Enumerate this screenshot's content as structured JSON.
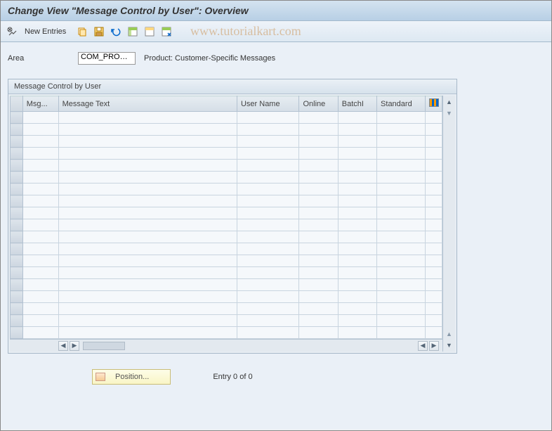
{
  "title": "Change View \"Message Control by User\": Overview",
  "toolbar": {
    "new_entries_label": "New Entries"
  },
  "watermark": "www.tutorialkart.com",
  "form": {
    "area_label": "Area",
    "area_value": "COM_PRO…",
    "area_desc": "Product: Customer-Specific Messages"
  },
  "panel": {
    "title": "Message Control by User",
    "columns": {
      "msg": "Msg...",
      "message_text": "Message Text",
      "user_name": "User Name",
      "online": "Online",
      "batch": "BatchI",
      "standard": "Standard"
    }
  },
  "footer": {
    "position_label": "Position...",
    "entry_text": "Entry 0 of 0"
  }
}
